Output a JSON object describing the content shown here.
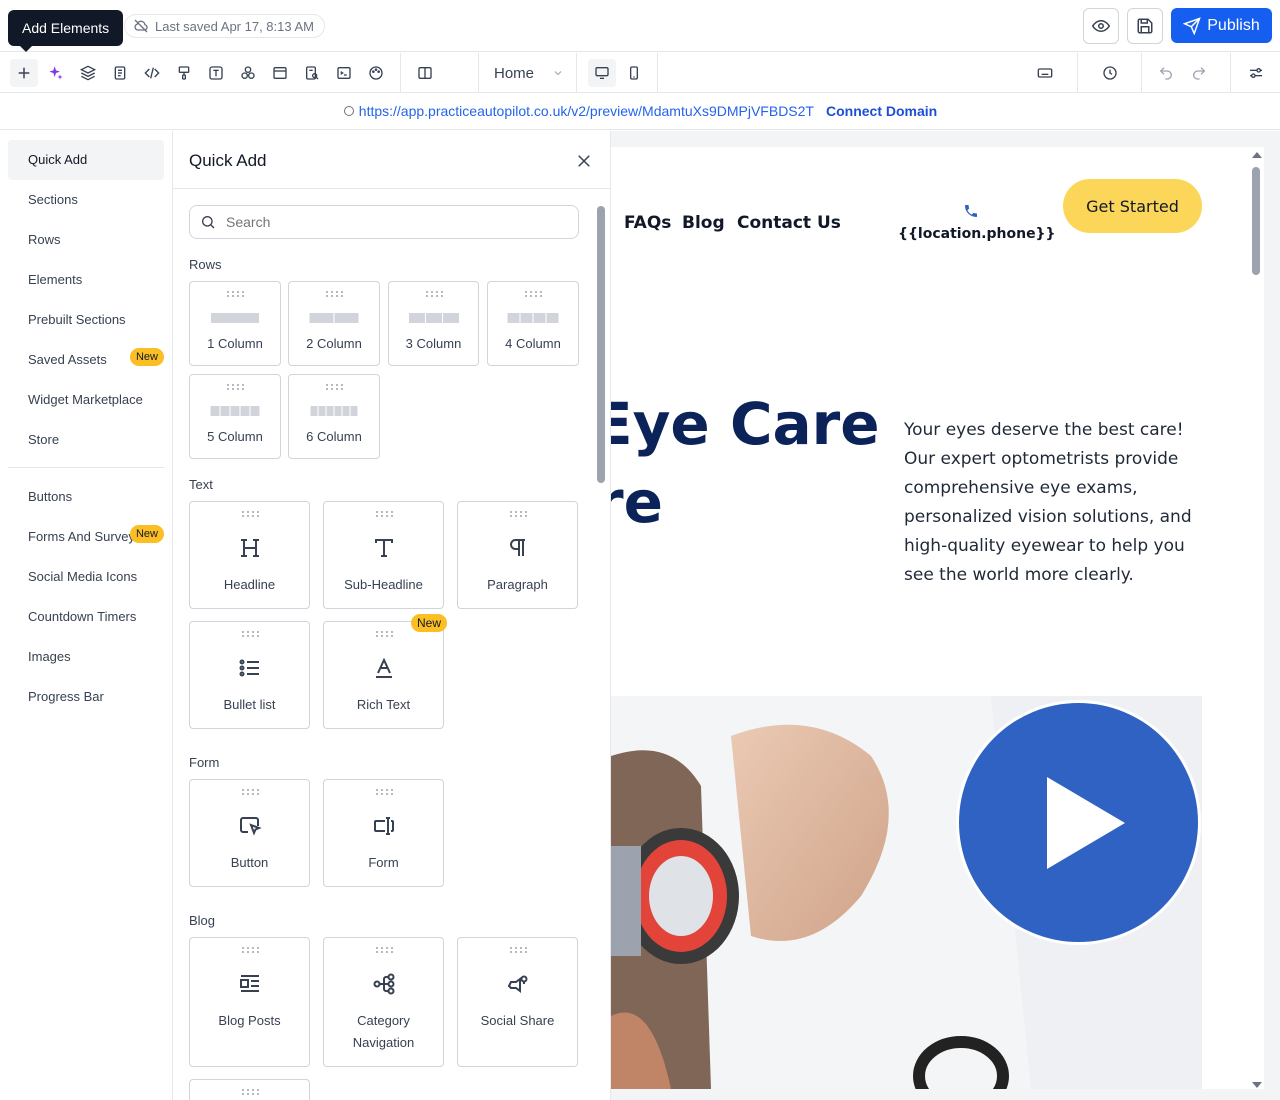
{
  "header": {
    "tooltip": "Add Elements",
    "last_saved": "Last saved Apr 17, 8:13 AM",
    "publish_label": "Publish",
    "accent": "#155eef"
  },
  "toolbar": {
    "page_select": "Home",
    "icons": [
      "plus-icon",
      "ai-sparkle-icon",
      "layers-icon",
      "page-icon",
      "code-icon",
      "paint-bucket-icon",
      "text-style-icon",
      "apps-icon",
      "layout-icon",
      "audit-icon",
      "terminal-icon",
      "palette-icon",
      "panel-icon",
      "desktop-icon",
      "mobile-icon",
      "keyboard-icon",
      "history-icon",
      "undo-icon",
      "redo-icon",
      "settings-icon"
    ]
  },
  "urlbar": {
    "url": "https://app.practiceautopilot.co.uk/v2/preview/MdamtuXs9DMPjVFBDS2T",
    "connect_domain": "Connect Domain"
  },
  "sidebar": {
    "items": [
      {
        "label": "Quick Add",
        "active": true
      },
      {
        "label": "Sections"
      },
      {
        "label": "Rows"
      },
      {
        "label": "Elements"
      },
      {
        "label": "Prebuilt Sections"
      },
      {
        "label": "Saved Assets",
        "badge": "New"
      },
      {
        "label": "Widget Marketplace"
      },
      {
        "label": "Store"
      },
      {
        "label": "Buttons"
      },
      {
        "label": "Forms And Surveys",
        "badge": "New"
      },
      {
        "label": "Social Media Icons"
      },
      {
        "label": "Countdown Timers"
      },
      {
        "label": "Images"
      },
      {
        "label": "Progress Bar"
      }
    ]
  },
  "panel": {
    "title": "Quick Add",
    "search_placeholder": "Search",
    "sections": {
      "rows": "Rows",
      "text": "Text",
      "form": "Form",
      "blog": "Blog"
    },
    "rows": [
      "1 Column",
      "2 Column",
      "3 Column",
      "4 Column",
      "5 Column",
      "6 Column"
    ],
    "text": [
      {
        "label": "Headline",
        "icon": "headline-icon"
      },
      {
        "label": "Sub-Headline",
        "icon": "sub-headline-icon"
      },
      {
        "label": "Paragraph",
        "icon": "paragraph-icon"
      },
      {
        "label": "Bullet list",
        "icon": "bullet-list-icon"
      },
      {
        "label": "Rich Text",
        "icon": "rich-text-icon",
        "badge": "New"
      }
    ],
    "form": [
      {
        "label": "Button",
        "icon": "button-icon"
      },
      {
        "label": "Form",
        "icon": "form-icon"
      }
    ],
    "blog": [
      {
        "label": "Blog Posts",
        "icon": "blog-posts-icon"
      },
      {
        "label": "Category Navigation",
        "icon": "category-navigation-icon"
      },
      {
        "label": "Social Share",
        "icon": "social-share-icon"
      }
    ]
  },
  "site": {
    "nav": [
      "FAQs",
      "Blog",
      "Contact Us"
    ],
    "phone": "{{location.phone}}",
    "cta": "Get Started",
    "hero_line1": "Eye Care",
    "hero_line2": "re",
    "hero_text": "Your eyes deserve the best care! Our expert optometrists provide comprehensive eye exams, personalized vision solutions, and high-quality eyewear to help you see the world more clearly.",
    "cta_color": "#fcd659",
    "heading_color": "#0b2358",
    "play_color": "#2f62c2"
  }
}
